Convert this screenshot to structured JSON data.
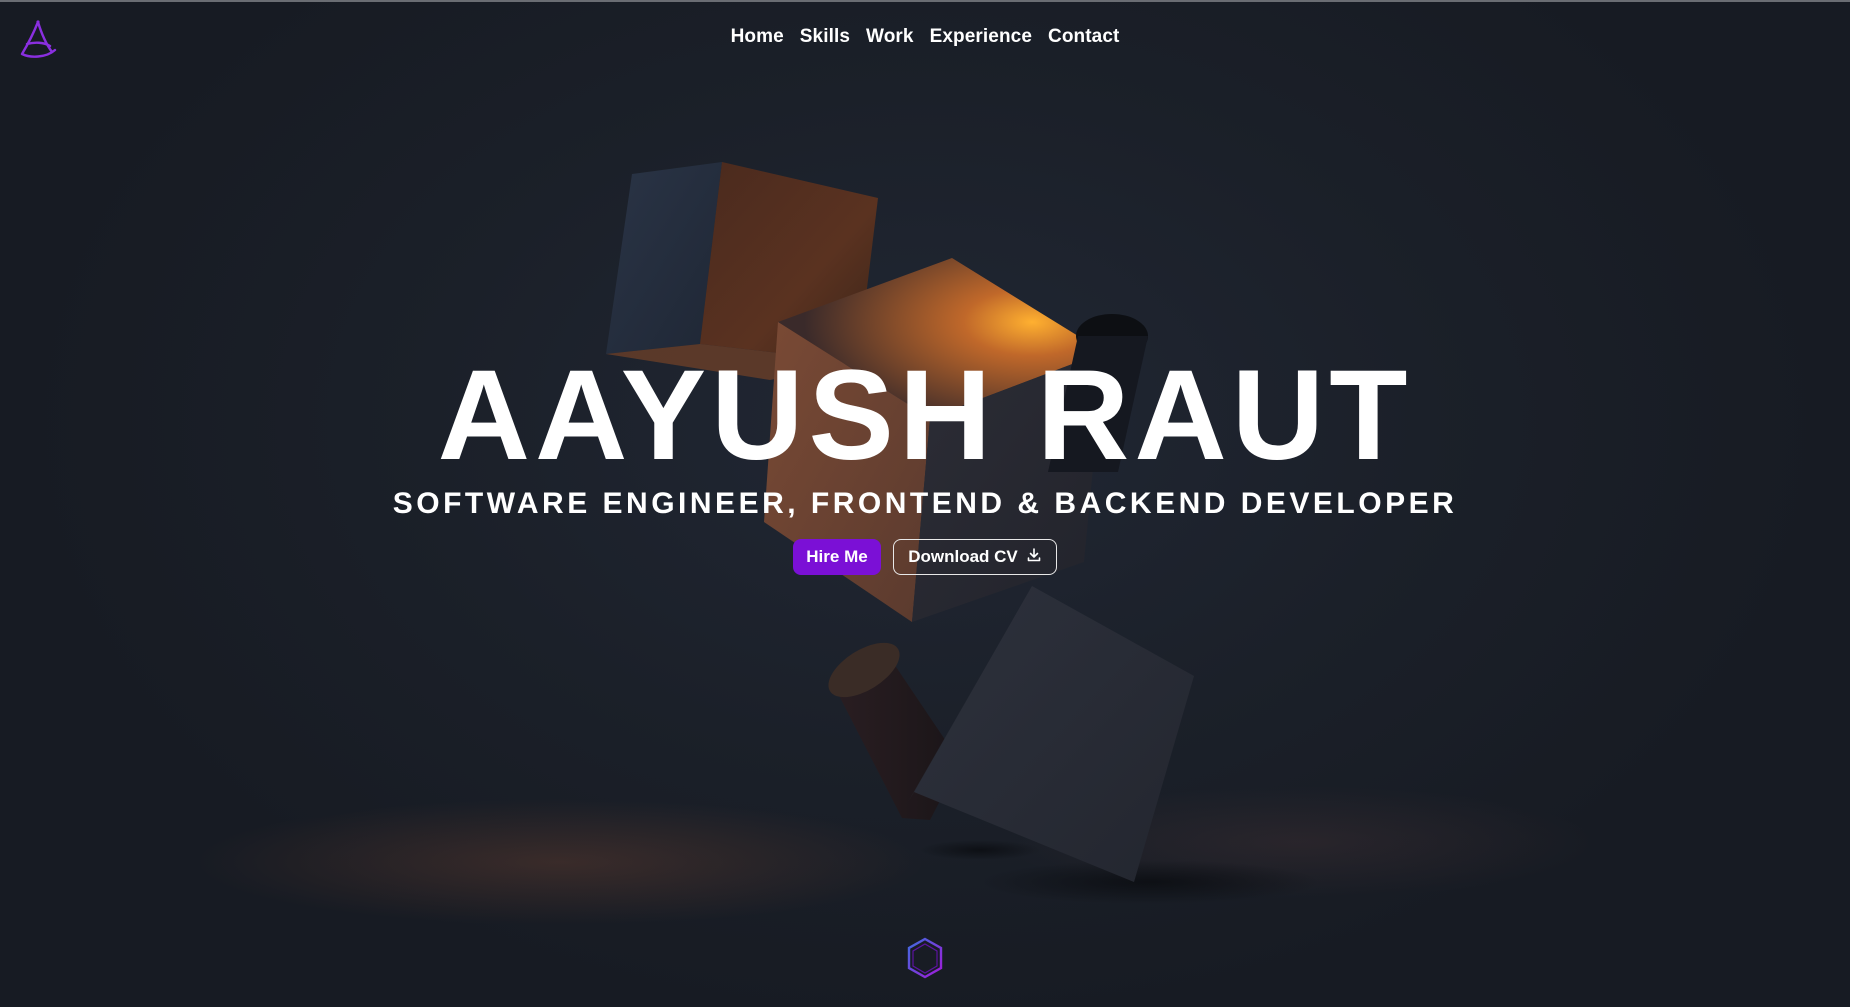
{
  "brand": {
    "logo_letter": "A",
    "logo_icon": "calligraphic-a-logo-icon",
    "accent_color": "#7b10d6"
  },
  "nav": {
    "items": [
      {
        "label": "Home"
      },
      {
        "label": "Skills"
      },
      {
        "label": "Work"
      },
      {
        "label": "Experience"
      },
      {
        "label": "Contact"
      }
    ]
  },
  "hero": {
    "title": "AAYUSH RAUT",
    "subtitle": "SOFTWARE ENGINEER, FRONTEND & BACKEND DEVELOPER",
    "hire_label": "Hire Me",
    "download_label": "Download CV",
    "download_icon": "download-icon",
    "background": "3d-floating-cubes-scene"
  },
  "scroll_indicator": {
    "icon": "hexagon-icon"
  },
  "colors": {
    "background": "#1b2029",
    "text": "#ffffff",
    "accent": "#7b10d6",
    "hexagon_stroke": "#5a3fd6"
  }
}
